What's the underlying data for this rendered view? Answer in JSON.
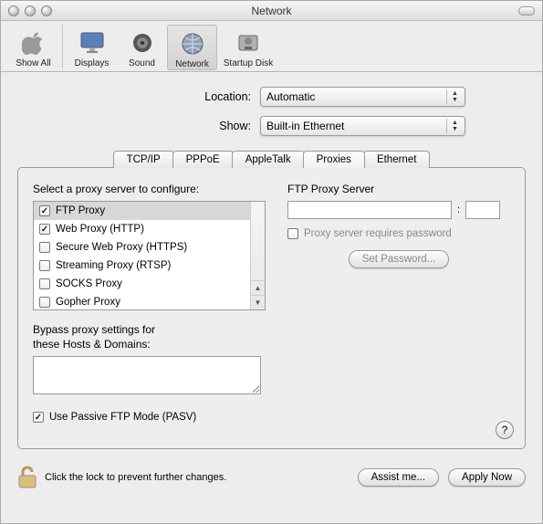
{
  "window": {
    "title": "Network"
  },
  "toolbar": {
    "items": [
      {
        "label": "Show All"
      },
      {
        "label": "Displays"
      },
      {
        "label": "Sound"
      },
      {
        "label": "Network"
      },
      {
        "label": "Startup Disk"
      }
    ]
  },
  "form": {
    "location_label": "Location:",
    "location_value": "Automatic",
    "show_label": "Show:",
    "show_value": "Built-in Ethernet"
  },
  "tabs": {
    "items": [
      {
        "label": "TCP/IP"
      },
      {
        "label": "PPPoE"
      },
      {
        "label": "AppleTalk"
      },
      {
        "label": "Proxies"
      },
      {
        "label": "Ethernet"
      }
    ],
    "active_index": 3
  },
  "proxies": {
    "select_label": "Select a proxy server to configure:",
    "items": [
      {
        "label": "FTP Proxy",
        "checked": true,
        "selected": true
      },
      {
        "label": "Web Proxy (HTTP)",
        "checked": true,
        "selected": false
      },
      {
        "label": "Secure Web Proxy (HTTPS)",
        "checked": false,
        "selected": false
      },
      {
        "label": "Streaming Proxy (RTSP)",
        "checked": false,
        "selected": false
      },
      {
        "label": "SOCKS Proxy",
        "checked": false,
        "selected": false
      },
      {
        "label": "Gopher Proxy",
        "checked": false,
        "selected": false
      }
    ],
    "server_label": "FTP Proxy Server",
    "server_value": "",
    "port_value": "",
    "requires_password_label": "Proxy server requires password",
    "requires_password_checked": false,
    "set_password_label": "Set Password...",
    "bypass_label_line1": "Bypass proxy settings for",
    "bypass_label_line2": "these Hosts & Domains:",
    "bypass_value": "",
    "passive_ftp_label": "Use Passive FTP Mode (PASV)",
    "passive_ftp_checked": true,
    "help": "?"
  },
  "footer": {
    "lock_text": "Click the lock to prevent further changes.",
    "assist_label": "Assist me...",
    "apply_label": "Apply Now"
  }
}
